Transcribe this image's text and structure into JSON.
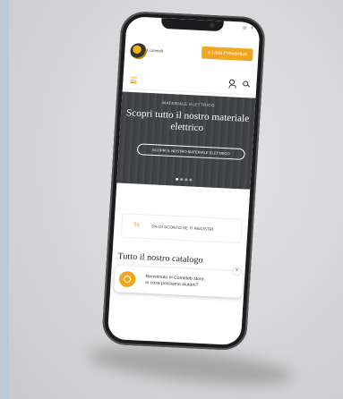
{
  "status": {
    "icons": [
      "instagram-icon",
      "facebook-icon"
    ],
    "ig": "◎",
    "fb": "f"
  },
  "header": {
    "logo_text": "Cometeb",
    "cta_label": "a Lista Preventivo"
  },
  "hero": {
    "tag": "MATERIALE ELETTRICO",
    "title": "Scopri tutto il nostro materiale elettrico",
    "button_label": "SCOPRI IL NOSTRO MATERIALE ELETTRICO"
  },
  "promo": {
    "icon": "%",
    "text": "5% DI SCONTO SE TI REGISTRI"
  },
  "catalog": {
    "title": "Tutto il nostro catalogo"
  },
  "chat": {
    "line1": "Benvenuto in Cometeb store,",
    "line2": "in cosa possiamo aiutarti?",
    "close": "×"
  },
  "colors": {
    "accent": "#f0a622"
  }
}
